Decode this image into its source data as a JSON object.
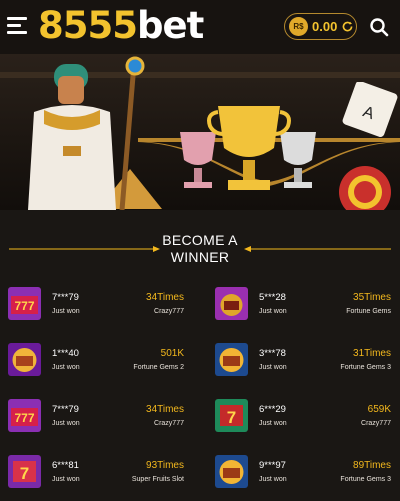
{
  "header": {
    "logo_number": "8555",
    "logo_word": "bet",
    "currency_symbol": "R$",
    "balance": "0.00"
  },
  "section": {
    "title_line1": "BECOME A",
    "title_line2": "WINNER"
  },
  "winners": [
    {
      "user": "7***79",
      "status": "Just won",
      "times": "34Times",
      "game": "Crazy777",
      "thumb": "crazy777"
    },
    {
      "user": "5***28",
      "status": "Just won",
      "times": "35Times",
      "game": "Fortune Gems",
      "thumb": "gems"
    },
    {
      "user": "1***40",
      "status": "Just won",
      "times": "501K",
      "game": "Fortune Gems 2",
      "thumb": "gems2"
    },
    {
      "user": "3***78",
      "status": "Just won",
      "times": "31Times",
      "game": "Fortune Gems 3",
      "thumb": "gems3"
    },
    {
      "user": "7***79",
      "status": "Just won",
      "times": "34Times",
      "game": "Crazy777",
      "thumb": "crazy777"
    },
    {
      "user": "6***29",
      "status": "Just won",
      "times": "659K",
      "game": "Crazy777",
      "thumb": "crazy777b"
    },
    {
      "user": "6***81",
      "status": "Just won",
      "times": "93Times",
      "game": "Super Fruits Slot",
      "thumb": "fruits"
    },
    {
      "user": "9***97",
      "status": "Just won",
      "times": "89Times",
      "game": "Fortune Gems 3",
      "thumb": "gems3"
    }
  ],
  "colors": {
    "accent": "#f3c32e",
    "times": "#f3b81d",
    "background": "#1a1714"
  }
}
